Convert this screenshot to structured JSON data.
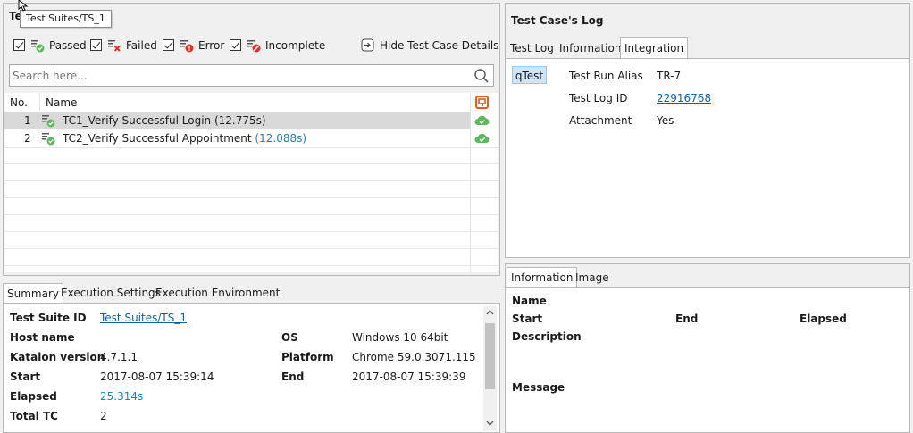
{
  "tooltip": "Test Suites/TS_1",
  "left_title_partial": "Te",
  "filters": {
    "passed": "Passed",
    "failed": "Failed",
    "error": "Error",
    "incomplete": "Incomplete",
    "hide_details": "Hide Test Case Details"
  },
  "search": {
    "placeholder": "Search here..."
  },
  "table": {
    "col_no": "No.",
    "col_name": "Name",
    "rows": [
      {
        "no": "1",
        "name": "TC1_Verify Successful Login",
        "time": "(12.775s)"
      },
      {
        "no": "2",
        "name": "TC2_Verify Successful Appointment",
        "time": "(12.088s)"
      }
    ]
  },
  "bottom_tabs": [
    "Summary",
    "Execution Settings",
    "Execution Environment"
  ],
  "summary": {
    "test_suite_id_label": "Test Suite ID",
    "test_suite_id": "Test Suites/TS_1",
    "host_name_label": "Host name",
    "katalon_version_label": "Katalon version",
    "katalon_version": "4.7.1.1",
    "start_label": "Start",
    "start": "2017-08-07 15:39:14",
    "elapsed_label": "Elapsed",
    "elapsed": "25.314s",
    "total_tc_label": "Total TC",
    "total_tc": "2",
    "os_label": "OS",
    "os": "Windows 10 64bit",
    "platform_label": "Platform",
    "platform": "Chrome 59.0.3071.115",
    "end_label": "End",
    "end": "2017-08-07 15:39:39"
  },
  "log": {
    "title": "Test Case's Log",
    "tabs": [
      "Test Log",
      "Information",
      "Integration"
    ],
    "qtest_label": "qTest",
    "run_alias_label": "Test Run Alias",
    "run_alias": "TR-7",
    "log_id_label": "Test Log ID",
    "log_id": "22916768",
    "attachment_label": "Attachment",
    "attachment": "Yes"
  },
  "info": {
    "tabs": [
      "Information",
      "Image"
    ],
    "name_label": "Name",
    "start_label": "Start",
    "end_label": "End",
    "elapsed_label": "Elapsed",
    "description_label": "Description",
    "message_label": "Message"
  },
  "colors": {
    "passed_green": "#5cb85c",
    "selected_row": "#d9d9d9",
    "link": "#0b61a4",
    "accent_orange": "#e85c0d",
    "qtest_bg": "#cfe4f7"
  }
}
